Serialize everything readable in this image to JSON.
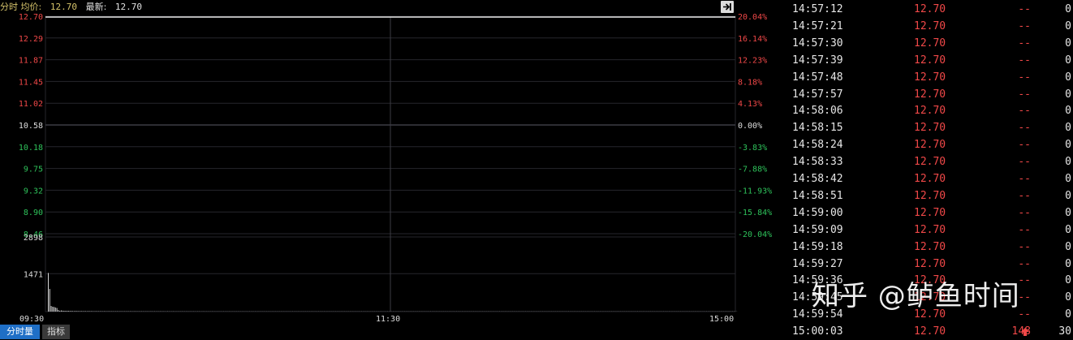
{
  "header": {
    "label": "分时 均价:",
    "avg_price": "12.70",
    "latest_label": "最新:",
    "latest_price": "12.70"
  },
  "colors": {
    "up": "#f04848",
    "down": "#2ec15a",
    "neutral": "#dcdcdc",
    "grid": "#26262c",
    "center_line": "#3c3c44",
    "bar": "#d8d8d8",
    "price_line": "#e8e8e8",
    "tab_active": "#1f6fc6"
  },
  "chart_data": {
    "type": "line",
    "price_axis": {
      "labels": [
        "12.70",
        "12.29",
        "11.87",
        "11.45",
        "11.02",
        "10.58",
        "10.18",
        "9.75",
        "9.32",
        "8.90",
        "8.46"
      ],
      "pct_labels": [
        "20.04%",
        "16.14%",
        "12.23%",
        "8.18%",
        "4.13%",
        "0.00%",
        "-3.83%",
        "-7.88%",
        "-11.93%",
        "-15.84%",
        "-20.04%"
      ],
      "ylim": [
        8.46,
        12.7
      ],
      "prev_close": 10.58
    },
    "price_series": {
      "value": 12.7
    },
    "volume_axis": {
      "labels": [
        "2898",
        "1471"
      ]
    },
    "volume_series": [
      1500,
      880,
      220,
      190,
      180,
      160,
      140,
      60,
      30,
      45,
      35,
      30,
      28,
      25,
      30,
      22,
      25,
      20,
      18,
      22,
      20,
      18,
      16,
      20,
      15,
      18,
      16,
      14,
      18,
      15,
      16,
      14,
      12,
      15,
      14,
      12,
      14,
      13,
      12,
      14,
      12,
      11,
      13,
      12,
      11,
      12,
      10,
      12,
      11,
      10,
      12,
      11,
      10,
      11,
      10,
      12,
      10,
      11,
      10,
      9,
      11,
      10,
      9,
      10,
      9,
      10,
      9,
      8,
      10,
      9,
      8,
      9,
      10,
      8,
      9,
      8,
      9,
      8,
      10,
      8,
      9,
      8,
      7,
      9,
      8,
      7,
      8,
      9,
      7,
      8,
      7,
      8,
      7,
      9,
      7,
      8,
      7,
      8,
      7,
      8,
      7,
      8,
      7,
      6,
      8,
      7,
      6,
      7,
      8,
      6,
      7,
      6,
      7,
      6,
      8,
      6,
      7,
      6,
      7,
      6,
      7,
      6,
      7,
      6,
      7,
      6,
      7,
      6,
      7,
      6,
      7,
      6,
      7,
      6,
      7,
      6,
      7,
      6,
      7,
      6,
      7,
      6,
      7,
      6,
      7,
      6,
      7,
      6,
      7,
      6,
      7,
      6,
      7,
      6,
      7,
      6,
      7,
      6,
      7,
      6,
      7,
      6,
      7,
      6,
      7,
      6,
      7,
      6,
      7,
      6,
      7,
      6,
      7,
      6,
      7,
      6,
      7,
      6,
      7,
      6,
      7,
      6,
      7,
      6,
      7,
      6,
      7,
      6,
      7,
      6,
      7,
      6,
      7,
      6,
      7,
      6,
      7,
      6,
      7,
      6,
      7,
      6,
      7,
      6,
      7,
      6,
      7,
      6,
      7,
      6,
      7,
      6,
      7,
      6,
      7,
      6,
      7,
      6,
      7,
      6,
      7,
      6,
      7,
      6,
      7,
      6,
      7,
      6,
      7,
      6,
      7,
      6,
      7,
      6,
      7,
      6,
      7,
      6,
      7,
      6,
      7,
      6,
      7,
      6,
      7,
      6,
      7,
      6,
      7,
      6,
      7,
      6,
      7,
      6,
      7,
      6,
      7,
      6,
      7,
      6,
      7,
      6,
      7,
      6,
      7,
      6,
      7,
      6,
      7,
      6,
      7,
      6,
      7,
      6,
      7,
      6,
      7,
      6,
      7,
      6,
      7,
      6,
      7,
      6,
      7,
      6,
      7,
      6,
      7,
      6,
      7,
      6,
      7,
      6,
      7,
      6,
      7,
      6,
      7,
      6,
      7,
      6,
      7,
      6,
      7,
      6,
      7,
      6,
      7,
      6,
      7,
      6,
      7,
      6,
      7,
      6,
      7,
      6,
      7,
      6,
      7,
      6,
      7,
      6,
      7,
      6,
      7,
      6,
      7,
      6,
      7,
      6,
      7,
      6,
      7,
      6,
      7,
      6,
      7,
      6,
      7,
      6,
      7,
      6,
      7,
      6,
      7,
      6,
      7,
      6,
      7,
      6,
      7,
      6,
      7,
      6,
      7,
      6,
      7,
      6,
      7,
      6,
      7,
      6,
      7,
      6,
      7,
      6,
      7,
      6,
      7,
      6,
      7,
      6,
      7,
      6,
      7,
      6,
      7,
      6,
      7,
      6,
      7,
      6,
      7,
      6,
      7,
      6,
      7,
      6,
      7,
      6,
      7,
      6,
      7,
      6,
      7,
      6,
      7,
      6,
      7,
      6,
      7,
      6,
      7,
      6,
      7,
      6,
      7,
      6,
      7,
      6,
      7,
      6,
      7,
      6,
      7,
      6,
      7,
      6,
      7,
      6,
      7,
      6,
      7,
      6,
      7,
      6,
      7,
      6,
      7,
      6,
      7,
      6,
      7,
      6,
      7,
      6,
      7,
      6,
      7,
      6,
      7,
      6,
      7,
      6,
      7,
      6,
      7,
      6,
      7,
      6,
      7,
      6,
      7,
      6,
      7,
      6,
      7,
      6,
      7,
      6,
      7,
      6,
      7,
      6,
      7,
      6,
      7,
      6,
      7,
      6,
      7,
      6,
      7,
      6,
      7,
      6,
      7,
      6
    ],
    "volume_ylim": [
      0,
      2898
    ],
    "time_labels": [
      "09:30",
      "11:30",
      "15:00"
    ]
  },
  "tabs": {
    "intraday_volume": "分时量",
    "indicator": "指标"
  },
  "ticks": [
    {
      "time": "14:57:12",
      "price": "12.70",
      "vol": "--",
      "count": "0"
    },
    {
      "time": "14:57:21",
      "price": "12.70",
      "vol": "--",
      "count": "0"
    },
    {
      "time": "14:57:30",
      "price": "12.70",
      "vol": "--",
      "count": "0"
    },
    {
      "time": "14:57:39",
      "price": "12.70",
      "vol": "--",
      "count": "0"
    },
    {
      "time": "14:57:48",
      "price": "12.70",
      "vol": "--",
      "count": "0"
    },
    {
      "time": "14:57:57",
      "price": "12.70",
      "vol": "--",
      "count": "0"
    },
    {
      "time": "14:58:06",
      "price": "12.70",
      "vol": "--",
      "count": "0"
    },
    {
      "time": "14:58:15",
      "price": "12.70",
      "vol": "--",
      "count": "0"
    },
    {
      "time": "14:58:24",
      "price": "12.70",
      "vol": "--",
      "count": "0"
    },
    {
      "time": "14:58:33",
      "price": "12.70",
      "vol": "--",
      "count": "0"
    },
    {
      "time": "14:58:42",
      "price": "12.70",
      "vol": "--",
      "count": "0"
    },
    {
      "time": "14:58:51",
      "price": "12.70",
      "vol": "--",
      "count": "0"
    },
    {
      "time": "14:59:00",
      "price": "12.70",
      "vol": "--",
      "count": "0"
    },
    {
      "time": "14:59:09",
      "price": "12.70",
      "vol": "--",
      "count": "0"
    },
    {
      "time": "14:59:18",
      "price": "12.70",
      "vol": "--",
      "count": "0"
    },
    {
      "time": "14:59:27",
      "price": "12.70",
      "vol": "--",
      "count": "0"
    },
    {
      "time": "14:59:36",
      "price": "12.70",
      "vol": "--",
      "count": "0"
    },
    {
      "time": "14:59:45",
      "price": "12.70",
      "vol": "--",
      "count": "0"
    },
    {
      "time": "14:59:54",
      "price": "12.70",
      "vol": "--",
      "count": "0"
    },
    {
      "time": "15:00:03",
      "price": "12.70",
      "vol": "148",
      "count": "30",
      "arrow": "up-arrow-icon"
    }
  ],
  "watermark": "知乎 @鲈鱼时间"
}
